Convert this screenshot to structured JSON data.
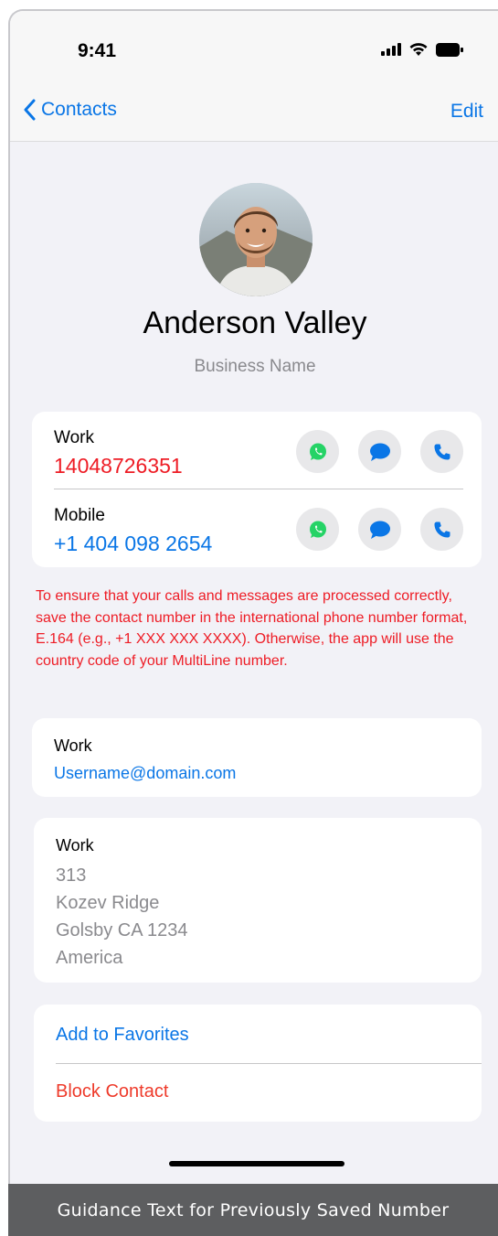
{
  "status_bar": {
    "time": "9:41"
  },
  "nav": {
    "back_label": "Contacts",
    "edit_label": "Edit"
  },
  "contact": {
    "name": "Anderson Valley",
    "business": "Business Name"
  },
  "phones": [
    {
      "label": "Work",
      "number": "14048726351",
      "color": "#ee1c25"
    },
    {
      "label": "Mobile",
      "number": "+1 404 098 2654",
      "color": "#0a76e6"
    }
  ],
  "guidance_text": "To ensure that your calls and messages are processed correctly, save the contact number in the international phone number format, E.164 (e.g., +1 XXX XXX XXXX). Otherwise, the app will use the country code of your MultiLine number.",
  "email": {
    "label": "Work",
    "value": "Username@domain.com"
  },
  "address": {
    "label": "Work",
    "lines": [
      "313",
      "Kozev Ridge",
      "Golsby CA 1234",
      "America"
    ]
  },
  "actions": {
    "favorite": "Add to Favorites",
    "block": "Block Contact"
  },
  "caption": "Guidance Text for Previously Saved Number",
  "colors": {
    "accent": "#0a76e6",
    "warning": "#ee1c25",
    "whatsapp": "#25d366"
  },
  "icons": [
    "back-chevron-icon",
    "signal-icon",
    "wifi-icon",
    "battery-icon",
    "whatsapp-icon",
    "message-icon",
    "phone-icon"
  ]
}
